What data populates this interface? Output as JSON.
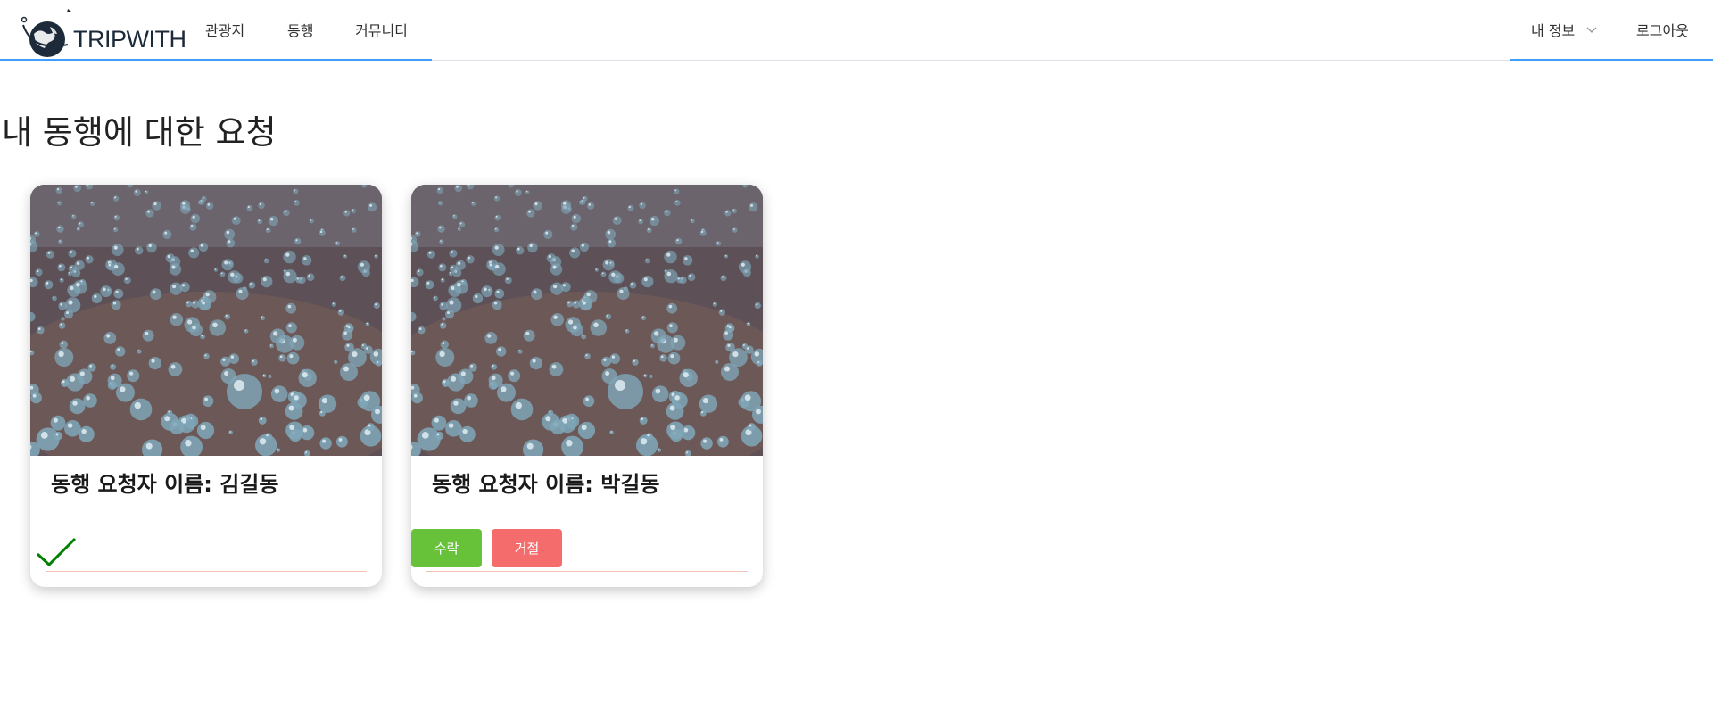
{
  "header": {
    "logo_text": "TRIPWITH",
    "nav": {
      "tour": "관광지",
      "companion": "동행",
      "community": "커뮤니티"
    },
    "my_info": "내 정보",
    "logout": "로그아웃"
  },
  "main": {
    "title": "내 동행에 대한 요청",
    "requests": [
      {
        "name_text": "동행 요청자 이름: 김길동",
        "status": "accepted",
        "status_icon": "check-icon"
      },
      {
        "name_text": "동행 요청자 이름: 박길동",
        "status": "pending",
        "accept_label": "수락",
        "reject_label": "거절"
      }
    ]
  },
  "colors": {
    "accent": "#409eff",
    "accept": "#67c23a",
    "reject": "#f56c6c",
    "check": "#008000"
  }
}
